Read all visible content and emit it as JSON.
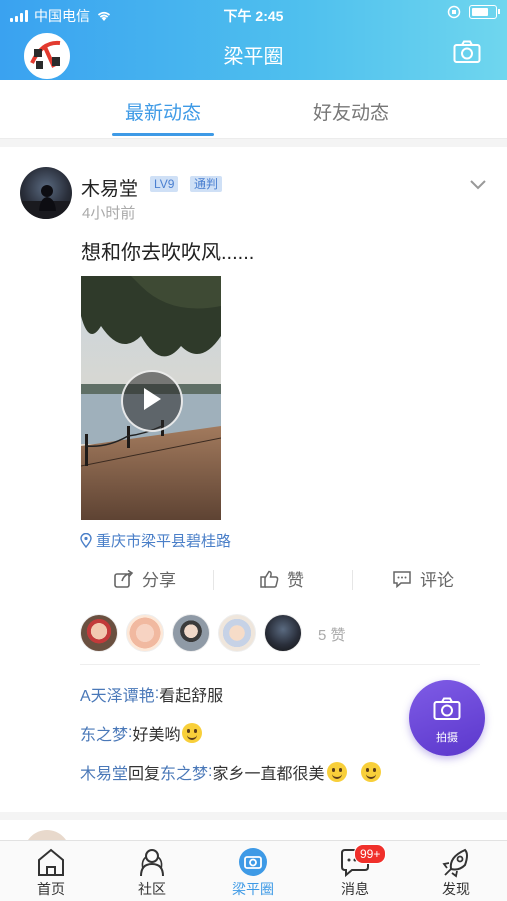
{
  "status_bar": {
    "carrier": "中国电信",
    "time": "下午 2:45"
  },
  "header": {
    "title": "梁平圈"
  },
  "tabs": [
    {
      "label": "最新动态",
      "active": true
    },
    {
      "label": "好友动态",
      "active": false
    }
  ],
  "post": {
    "username": "木易堂",
    "level_badge": "LV9",
    "role_badge": "通判",
    "time_ago": "4小时前",
    "content": "想和你去吹吹风......",
    "location": "重庆市梁平县碧桂路",
    "actions": {
      "share": "分享",
      "like": "赞",
      "comment": "评论"
    },
    "likes_text": "5 赞",
    "comments": [
      {
        "author": "A天泽谭艳",
        "sep": ": ",
        "text": "看起舒服",
        "emoji_count": 0
      },
      {
        "author": "东之梦",
        "sep": ": ",
        "text": "好美哟",
        "emoji_count": 1
      },
      {
        "author": "木易堂",
        "reply_word": "回复",
        "reply_to": "东之梦",
        "sep": ": ",
        "text": "家乡一直都很美",
        "emoji_count": 2
      }
    ]
  },
  "fab": {
    "label": "拍摄"
  },
  "navbar": [
    {
      "label": "首页",
      "icon": "home-icon"
    },
    {
      "label": "社区",
      "icon": "community-icon"
    },
    {
      "label": "梁平圈",
      "icon": "circle-camera-icon",
      "active": true
    },
    {
      "label": "消息",
      "icon": "message-icon",
      "badge": "99+"
    },
    {
      "label": "发现",
      "icon": "rocket-icon"
    }
  ],
  "colors": {
    "accent": "#3e9ae6",
    "header_gradient_start": "#3aa2f0",
    "header_gradient_end": "#6fd6ee",
    "fab": "#6b49d8",
    "badge_red": "#f0302b",
    "link": "#4a78b8"
  }
}
